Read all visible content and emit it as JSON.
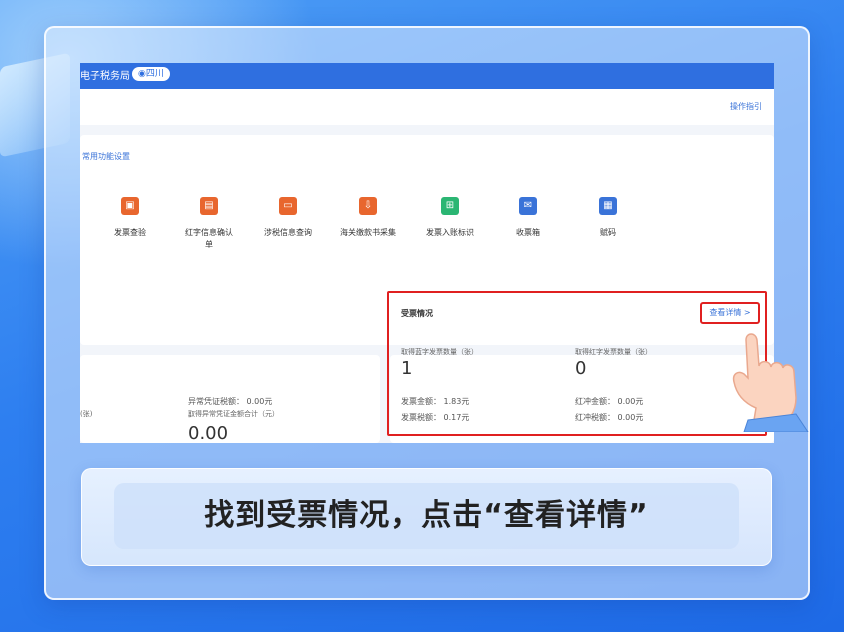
{
  "header": {
    "brand": "电子税务局",
    "region": "四川",
    "guide_link": "操作指引"
  },
  "favorites": {
    "title": "常用功能设置",
    "items": [
      {
        "label": "发票查验",
        "icon": "invoice-check-icon",
        "color": "#e8662e"
      },
      {
        "label": "红字信息确认单",
        "icon": "red-invoice-icon",
        "color": "#e8662e"
      },
      {
        "label": "涉税信息查询",
        "icon": "tax-info-icon",
        "color": "#e8662e"
      },
      {
        "label": "海关缴款书采集",
        "icon": "customs-icon",
        "color": "#e8662e"
      },
      {
        "label": "发票入账标识",
        "icon": "accounting-mark-icon",
        "color": "#2bb673"
      },
      {
        "label": "收票箱",
        "icon": "mailbox-icon",
        "color": "#3a73d8"
      },
      {
        "label": "赋码",
        "icon": "qr-code-icon",
        "color": "#3a73d8"
      }
    ]
  },
  "abnormal": {
    "left_label": "(张)",
    "total_label": "取得异常凭证金额合计（元）",
    "total_value": "0.00",
    "tax_label": "异常凭证税额：",
    "tax_value": "0.00元",
    "dash": "-"
  },
  "received": {
    "title": "受票情况",
    "detail_link": "查看详情 >",
    "blue_label": "取得蓝字发票数量（张）",
    "blue_value": "1",
    "blue_amount_label": "发票金额：",
    "blue_amount_value": "1.83元",
    "blue_tax_label": "发票税额：",
    "blue_tax_value": "0.17元",
    "red_label": "取得红字发票数量（张）",
    "red_value": "0",
    "red_amount_label": "红冲金额：",
    "red_amount_value": "0.00元",
    "red_tax_label": "红冲税额：",
    "red_tax_value": "0.00元"
  },
  "caption": "找到受票情况，点击“查看详情”",
  "colors": {
    "header": "#2f6fe0",
    "highlight": "#e02020",
    "link": "#3a73d8"
  }
}
